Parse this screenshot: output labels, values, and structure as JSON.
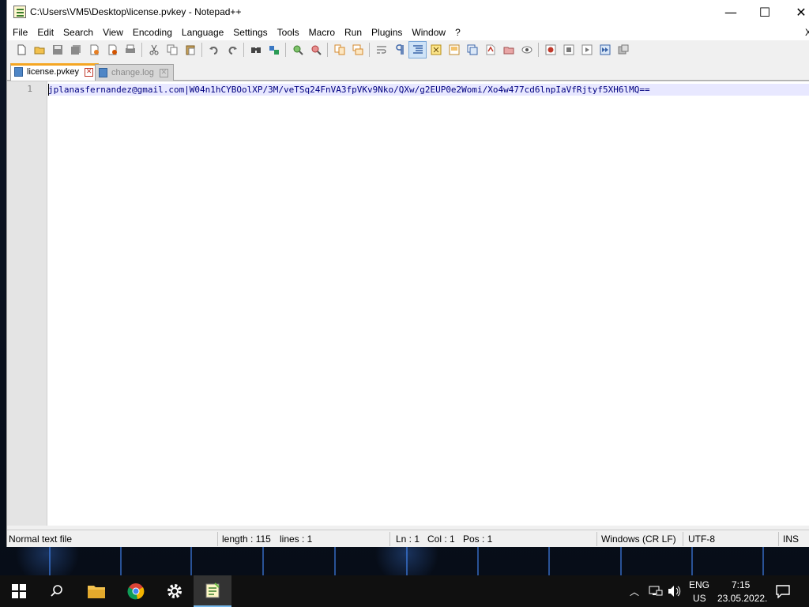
{
  "window": {
    "title": "C:\\Users\\VM5\\Desktop\\license.pvkey - Notepad++",
    "minimize_glyph": "—",
    "maximize_glyph": "☐",
    "close_glyph": "✕"
  },
  "menu": {
    "items": [
      "File",
      "Edit",
      "Search",
      "View",
      "Encoding",
      "Language",
      "Settings",
      "Tools",
      "Macro",
      "Run",
      "Plugins",
      "Window",
      "?"
    ],
    "close_glyph": "X"
  },
  "toolbar": {
    "icons": [
      "new-file-icon",
      "open-file-icon",
      "save-icon",
      "save-all-icon",
      "close-icon",
      "close-all-icon",
      "print-icon",
      "cut-icon",
      "copy-icon",
      "paste-icon",
      "undo-icon",
      "redo-icon",
      "find-icon",
      "replace-icon",
      "zoom-in-icon",
      "zoom-out-icon",
      "sync-vertical-icon",
      "sync-horizontal-icon",
      "word-wrap-icon",
      "show-all-characters-icon",
      "indent-guide-icon",
      "user-language-icon",
      "document-map-icon",
      "function-list-icon",
      "folder-workspace-icon",
      "monitoring-icon",
      "record-macro-icon",
      "stop-macro-icon",
      "play-macro-icon",
      "run-macro-multiple-icon",
      "save-macro-icon"
    ]
  },
  "tabs": [
    {
      "label": "license.pvkey",
      "active": true
    },
    {
      "label": "change.log",
      "active": false
    }
  ],
  "editor": {
    "lines": [
      {
        "number": "1",
        "text": "jplanasfernandez@gmail.com|W04n1hCYBOolXP/3M/veTSq24FnVA3fpVKv9Nko/QXw/g2EUP0e2Womi/Xo4w477cd6lnpIaVfRjtyf5XH6lMQ=="
      }
    ]
  },
  "status": {
    "file_type": "Normal text file",
    "length": "length : 115",
    "lines": "lines : 1",
    "ln": "Ln : 1",
    "col": "Col : 1",
    "pos": "Pos : 1",
    "eol": "Windows (CR LF)",
    "encoding": "UTF-8",
    "mode": "INS"
  },
  "taskbar": {
    "language": "ENG",
    "region": "US",
    "time": "7:15",
    "date": "23.05.2022."
  }
}
